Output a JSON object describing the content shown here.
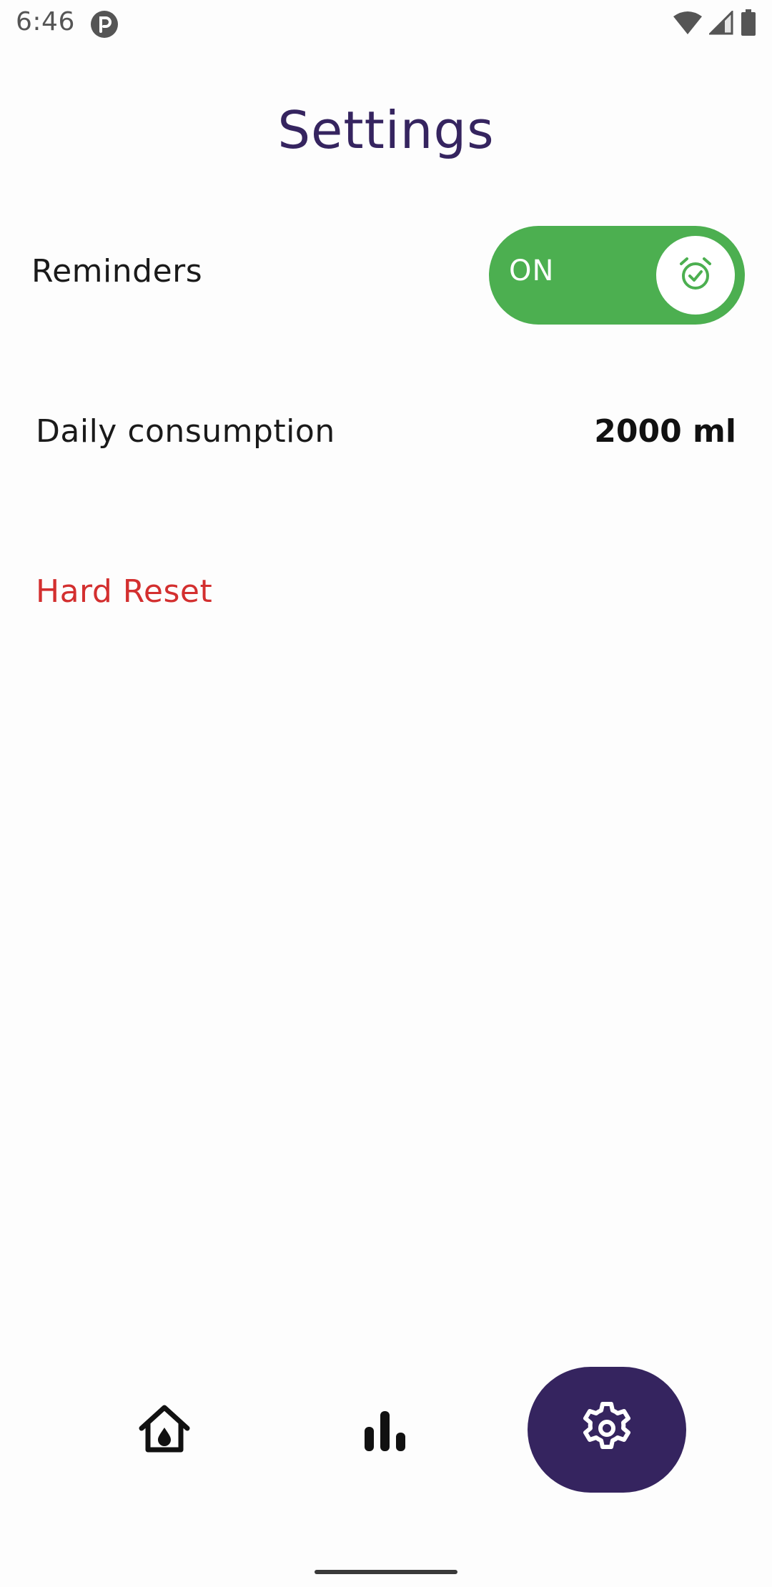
{
  "status_bar": {
    "time": "6:46",
    "app_icon": "podcast-p-icon",
    "icons": [
      "wifi-icon",
      "cell-signal-icon",
      "battery-icon"
    ]
  },
  "page": {
    "title": "Settings"
  },
  "settings": {
    "reminders": {
      "label": "Reminders",
      "toggle_text": "ON",
      "toggle_state": true,
      "knob_icon": "alarm-check-icon"
    },
    "daily_consumption": {
      "label": "Daily consumption",
      "value": "2000 ml"
    },
    "hard_reset": {
      "label": "Hard Reset"
    }
  },
  "bottom_nav": {
    "items": [
      {
        "icon": "home-water-drop-icon",
        "active": false
      },
      {
        "icon": "bar-chart-icon",
        "active": false
      },
      {
        "icon": "gear-icon",
        "active": true
      }
    ]
  },
  "colors": {
    "primary": "#35245f",
    "toggle_on": "#4caf50",
    "danger": "#d32f2f",
    "background": "#fdfdfd"
  }
}
